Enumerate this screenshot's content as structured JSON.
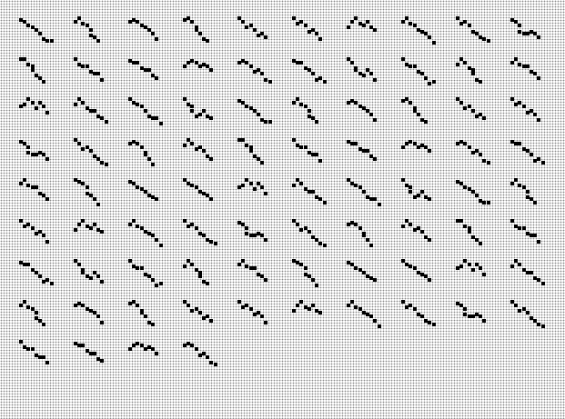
{
  "colors": {
    "background": "#ffffff",
    "grid_dot": "#8c8c8c",
    "mark": "#000000"
  },
  "layout_note_free": true,
  "grid": {
    "columns": 10,
    "rows": 9,
    "total_patterns": 84
  },
  "patterns": [
    [
      [
        0,
        0
      ],
      [
        1,
        1
      ],
      [
        2,
        2
      ],
      [
        3,
        2
      ],
      [
        4,
        3
      ],
      [
        5,
        4
      ],
      [
        6,
        5
      ],
      [
        7,
        6
      ],
      [
        8,
        6
      ]
    ],
    [
      [
        0,
        0
      ],
      [
        1,
        0
      ],
      [
        2,
        1
      ],
      [
        3,
        2
      ],
      [
        3,
        3
      ],
      [
        4,
        4
      ],
      [
        5,
        5
      ],
      [
        6,
        6
      ]
    ],
    [
      [
        0,
        2
      ],
      [
        1,
        1
      ],
      [
        2,
        0
      ],
      [
        3,
        1
      ],
      [
        4,
        2
      ],
      [
        5,
        1
      ],
      [
        6,
        2
      ],
      [
        7,
        3
      ]
    ],
    [
      [
        0,
        0
      ],
      [
        1,
        1
      ],
      [
        2,
        2
      ],
      [
        2,
        3
      ],
      [
        3,
        4
      ],
      [
        4,
        4
      ],
      [
        5,
        3
      ],
      [
        6,
        4
      ],
      [
        7,
        5
      ]
    ],
    [
      [
        0,
        1
      ],
      [
        1,
        0
      ],
      [
        2,
        1
      ],
      [
        3,
        2
      ],
      [
        4,
        2
      ],
      [
        5,
        3
      ],
      [
        6,
        4
      ],
      [
        7,
        5
      ]
    ],
    [
      [
        0,
        0
      ],
      [
        1,
        1
      ],
      [
        2,
        1
      ],
      [
        3,
        2
      ],
      [
        4,
        3
      ],
      [
        5,
        3
      ],
      [
        6,
        4
      ],
      [
        7,
        5
      ]
    ],
    [
      [
        0,
        0
      ],
      [
        1,
        1
      ],
      [
        2,
        1
      ],
      [
        3,
        2
      ],
      [
        4,
        3
      ],
      [
        5,
        4
      ],
      [
        6,
        5
      ],
      [
        7,
        5
      ],
      [
        8,
        6
      ]
    ],
    [
      [
        0,
        1
      ],
      [
        1,
        0
      ],
      [
        2,
        1
      ],
      [
        3,
        2
      ],
      [
        4,
        3
      ],
      [
        4,
        4
      ],
      [
        5,
        5
      ],
      [
        6,
        6
      ]
    ],
    [
      [
        0,
        0
      ],
      [
        1,
        1
      ],
      [
        2,
        2
      ],
      [
        3,
        2
      ],
      [
        4,
        3
      ],
      [
        5,
        4
      ],
      [
        6,
        4
      ],
      [
        7,
        5
      ]
    ],
    [
      [
        0,
        1
      ],
      [
        1,
        0
      ],
      [
        2,
        1
      ],
      [
        3,
        2
      ],
      [
        4,
        3
      ],
      [
        5,
        3
      ],
      [
        6,
        4
      ],
      [
        7,
        5
      ],
      [
        8,
        6
      ]
    ]
  ]
}
